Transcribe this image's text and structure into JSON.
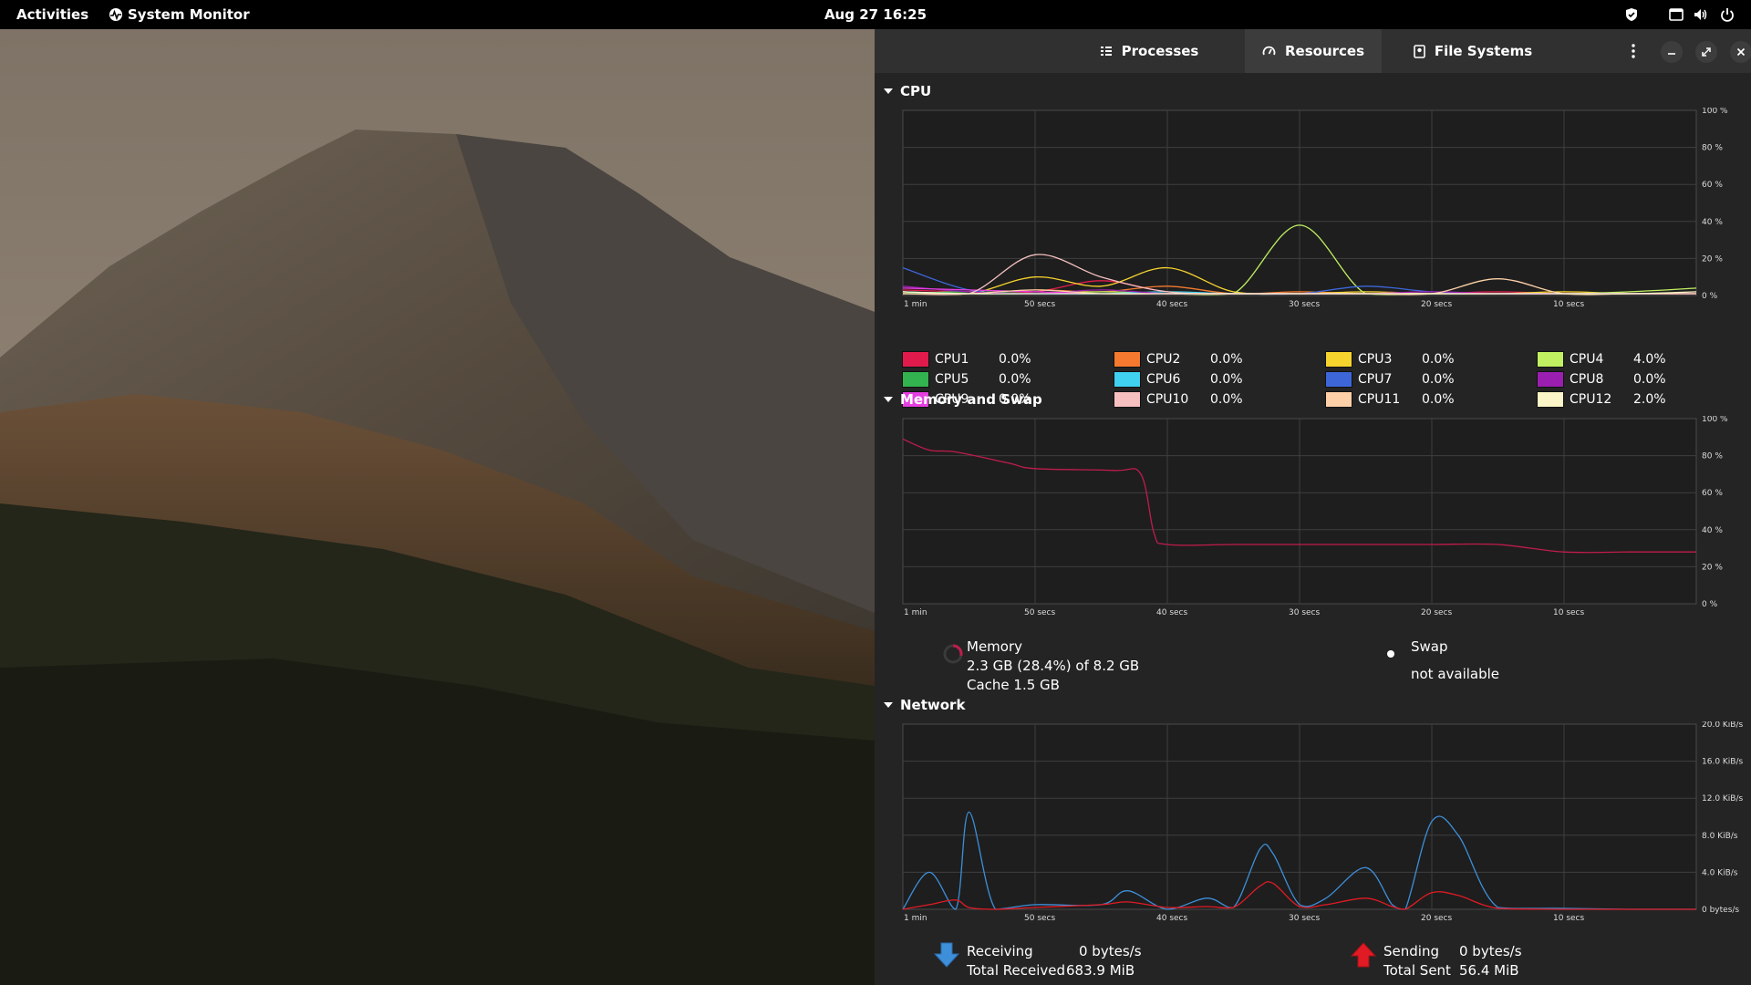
{
  "topbar": {
    "activities": "Activities",
    "app_name": "System Monitor",
    "clock": "Aug 27  16:25",
    "tray_icons": [
      "shield-icon",
      "window-icon",
      "volume-icon",
      "power-icon"
    ]
  },
  "tabs": [
    {
      "label": "Processes",
      "icon": "list-icon",
      "active": false
    },
    {
      "label": "Resources",
      "icon": "gauge-icon",
      "active": true
    },
    {
      "label": "File Systems",
      "icon": "disk-icon",
      "active": false
    }
  ],
  "x_ticks": [
    "1 min",
    "50 secs",
    "40 secs",
    "30 secs",
    "20 secs",
    "10 secs"
  ],
  "cpu": {
    "title": "CPU",
    "y_ticks": [
      "100 %",
      "80 %",
      "60 %",
      "40 %",
      "20 %",
      "0 %"
    ],
    "legend": [
      {
        "name": "CPU1",
        "value": "0.0%",
        "color": "#e01b4c"
      },
      {
        "name": "CPU2",
        "value": "0.0%",
        "color": "#f57a2f"
      },
      {
        "name": "CPU3",
        "value": "0.0%",
        "color": "#f6d32d"
      },
      {
        "name": "CPU4",
        "value": "4.0%",
        "color": "#c0f061"
      },
      {
        "name": "CPU5",
        "value": "0.0%",
        "color": "#33b34f"
      },
      {
        "name": "CPU6",
        "value": "0.0%",
        "color": "#40d0f0"
      },
      {
        "name": "CPU7",
        "value": "0.0%",
        "color": "#3d67d9"
      },
      {
        "name": "CPU8",
        "value": "0.0%",
        "color": "#9a1fb0"
      },
      {
        "name": "CPU9",
        "value": "0.0%",
        "color": "#e63fe0"
      },
      {
        "name": "CPU10",
        "value": "0.0%",
        "color": "#f7c0c0"
      },
      {
        "name": "CPU11",
        "value": "0.0%",
        "color": "#fdd0a8"
      },
      {
        "name": "CPU12",
        "value": "2.0%",
        "color": "#fcf5c8"
      }
    ]
  },
  "memory": {
    "title": "Memory and Swap",
    "y_ticks": [
      "100 %",
      "80 %",
      "60 %",
      "40 %",
      "20 %",
      "0 %"
    ],
    "memory_label": "Memory",
    "memory_usage": "2.3 GB (28.4%) of 8.2 GB",
    "cache": "Cache 1.5 GB",
    "memory_color": "#c01c4c",
    "swap_label": "Swap",
    "swap_status": "not available"
  },
  "network": {
    "title": "Network",
    "y_ticks": [
      "20.0 KiB/s",
      "16.0 KiB/s",
      "12.0 KiB/s",
      "8.0 KiB/s",
      "4.0 KiB/s",
      "0 bytes/s"
    ],
    "receiving_label": "Receiving",
    "receiving_rate": "0 bytes/s",
    "total_received_label": "Total Received",
    "total_received": "683.9 MiB",
    "sending_label": "Sending",
    "sending_rate": "0 bytes/s",
    "total_sent_label": "Total Sent",
    "total_sent": "56.4 MiB",
    "receive_color": "#3d8fd9",
    "send_color": "#e01b24"
  },
  "chart_data": [
    {
      "type": "line",
      "title": "CPU",
      "x": [
        60,
        55,
        50,
        45,
        40,
        35,
        30,
        25,
        20,
        15,
        10,
        5,
        0
      ],
      "ylim": [
        0,
        100
      ],
      "series": [
        {
          "name": "CPU1",
          "values": [
            3,
            2,
            2,
            8,
            2,
            1,
            1,
            1,
            1,
            2,
            1,
            1,
            1
          ]
        },
        {
          "name": "CPU2",
          "values": [
            2,
            1,
            3,
            2,
            5,
            1,
            2,
            1,
            1,
            1,
            1,
            1,
            1
          ]
        },
        {
          "name": "CPU3",
          "values": [
            2,
            1,
            10,
            5,
            15,
            2,
            1,
            2,
            1,
            1,
            2,
            1,
            1
          ]
        },
        {
          "name": "CPU4",
          "values": [
            1,
            2,
            1,
            2,
            1,
            1,
            38,
            1,
            1,
            1,
            1,
            2,
            4
          ]
        },
        {
          "name": "CPU5",
          "values": [
            1,
            2,
            1,
            1,
            1,
            1,
            1,
            1,
            1,
            1,
            1,
            1,
            1
          ]
        },
        {
          "name": "CPU6",
          "values": [
            2,
            1,
            1,
            1,
            2,
            1,
            1,
            1,
            1,
            1,
            1,
            1,
            1
          ]
        },
        {
          "name": "CPU7",
          "values": [
            15,
            3,
            1,
            1,
            1,
            1,
            1,
            5,
            2,
            1,
            1,
            1,
            1
          ]
        },
        {
          "name": "CPU8",
          "values": [
            5,
            2,
            1,
            3,
            1,
            1,
            1,
            1,
            2,
            1,
            1,
            1,
            1
          ]
        },
        {
          "name": "CPU9",
          "values": [
            4,
            3,
            2,
            1,
            1,
            1,
            1,
            1,
            1,
            1,
            1,
            1,
            1
          ]
        },
        {
          "name": "CPU10",
          "values": [
            1,
            1,
            22,
            10,
            2,
            1,
            1,
            1,
            1,
            1,
            1,
            1,
            1
          ]
        },
        {
          "name": "CPU11",
          "values": [
            1,
            1,
            3,
            1,
            1,
            1,
            1,
            1,
            1,
            9,
            1,
            1,
            1
          ]
        },
        {
          "name": "CPU12",
          "values": [
            2,
            1,
            1,
            1,
            1,
            1,
            1,
            1,
            1,
            1,
            1,
            1,
            2
          ]
        }
      ]
    },
    {
      "type": "line",
      "title": "Memory and Swap",
      "x": [
        60,
        58,
        56,
        52,
        50,
        44,
        42,
        41,
        40,
        35,
        30,
        25,
        20,
        15,
        10,
        5,
        0
      ],
      "ylim": [
        0,
        100
      ],
      "series": [
        {
          "name": "Memory",
          "values": [
            89,
            83,
            82,
            76,
            73,
            72,
            70,
            38,
            32,
            32,
            32,
            32,
            32,
            32,
            28,
            28,
            28
          ]
        }
      ]
    },
    {
      "type": "line",
      "title": "Network",
      "x": [
        60,
        58,
        56,
        55,
        53,
        50,
        45,
        43,
        40,
        37,
        35,
        33,
        32,
        30,
        28,
        25,
        23,
        22,
        20,
        18,
        15,
        10,
        5,
        0
      ],
      "ylim": [
        0,
        20
      ],
      "series": [
        {
          "name": "Receiving",
          "values": [
            0,
            4,
            0,
            10.5,
            0,
            0.5,
            0.5,
            2,
            0,
            1.2,
            0.2,
            6.5,
            6,
            0.5,
            1.2,
            4.5,
            0.5,
            0,
            9.5,
            8,
            0.2,
            0.1,
            0,
            0
          ]
        },
        {
          "name": "Sending",
          "values": [
            0,
            0.5,
            1,
            0.2,
            0,
            0.2,
            0.5,
            0.8,
            0.2,
            0.3,
            0.2,
            2.5,
            2.8,
            0.3,
            0.5,
            1.2,
            0.3,
            0,
            1.8,
            1.5,
            0.1,
            0,
            0,
            0
          ]
        }
      ]
    }
  ]
}
